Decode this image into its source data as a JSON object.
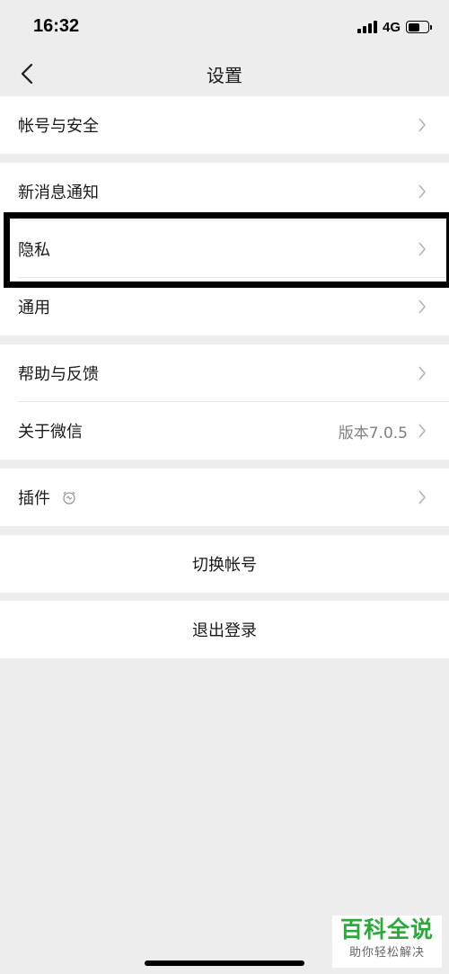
{
  "status_bar": {
    "time": "16:32",
    "network": "4G",
    "signal_bars": 4,
    "battery_level": 0.6
  },
  "nav": {
    "back_icon": "chevron-left-icon",
    "title": "设置"
  },
  "groups": [
    {
      "items": [
        {
          "label": "帐号与安全"
        }
      ]
    },
    {
      "items": [
        {
          "label": "新消息通知"
        },
        {
          "label": "隐私"
        },
        {
          "label": "通用"
        }
      ]
    },
    {
      "items": [
        {
          "label": "帮助与反馈"
        },
        {
          "label": "关于微信",
          "value": "版本7.0.5"
        }
      ]
    },
    {
      "items": [
        {
          "label": "插件",
          "icon": "plugin-icon"
        }
      ]
    }
  ],
  "actions": {
    "switch_account": "切换帐号",
    "logout": "退出登录"
  },
  "watermark": {
    "title": "百科全说",
    "subtitle": "助你轻松解决"
  },
  "colors": {
    "background": "#ededed",
    "cell": "#ffffff",
    "divider": "#e5e5e5",
    "secondary_text": "#7f7f7f",
    "chevron": "#b2b2b2",
    "watermark_green": "#2aaa3a"
  }
}
